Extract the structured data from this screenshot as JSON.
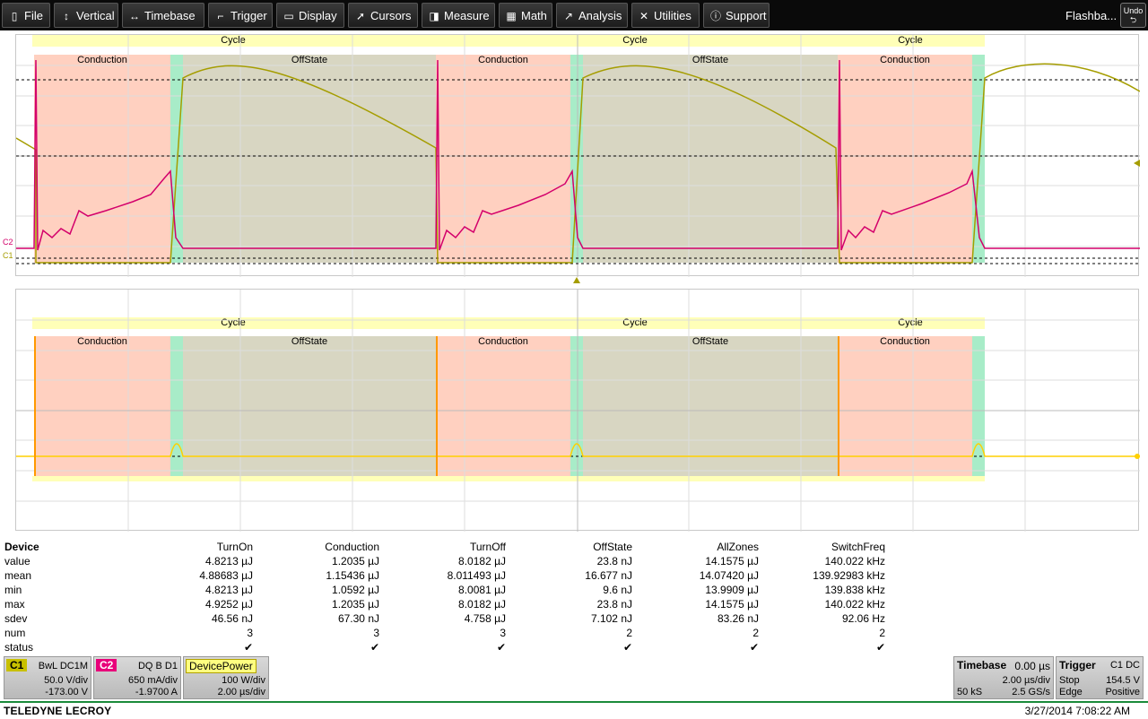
{
  "menu": {
    "file": "File",
    "vertical": "Vertical",
    "timebase": "Timebase",
    "trigger": "Trigger",
    "display": "Display",
    "cursors": "Cursors",
    "measure": "Measure",
    "math": "Math",
    "analysis": "Analysis",
    "utilities": "Utilities",
    "support": "Support",
    "flashback": "Flashba...",
    "undo": "Undo"
  },
  "zones": {
    "cycle": "Cycle",
    "conduction": "Conduction",
    "offstate": "OffState"
  },
  "trace_labels": {
    "c2": "C2",
    "c1": "C1"
  },
  "colors": {
    "conduction": "#ffd0c0",
    "offstate": "#d8d6c2",
    "transition": "#a8ecc8",
    "cycle": "#ffffb8",
    "ch1": "#a59d00",
    "ch2": "#d3006b",
    "device_power": "#ff9900"
  },
  "table": {
    "header": [
      "Device",
      "TurnOn",
      "Conduction",
      "TurnOff",
      "OffState",
      "AllZones",
      "SwitchFreq"
    ],
    "rows": [
      {
        "label": "value",
        "vals": [
          "4.8213 µJ",
          "1.2035 µJ",
          "8.0182 µJ",
          "23.8 nJ",
          "14.1575 µJ",
          "140.022 kHz"
        ]
      },
      {
        "label": "mean",
        "vals": [
          "4.88683 µJ",
          "1.15436 µJ",
          "8.011493 µJ",
          "16.677 nJ",
          "14.07420 µJ",
          "139.92983 kHz"
        ]
      },
      {
        "label": "min",
        "vals": [
          "4.8213 µJ",
          "1.0592 µJ",
          "8.0081 µJ",
          "9.6 nJ",
          "13.9909 µJ",
          "139.838 kHz"
        ]
      },
      {
        "label": "max",
        "vals": [
          "4.9252 µJ",
          "1.2035 µJ",
          "8.0182 µJ",
          "23.8 nJ",
          "14.1575 µJ",
          "140.022 kHz"
        ]
      },
      {
        "label": "sdev",
        "vals": [
          "46.56 nJ",
          "67.30 nJ",
          "4.758 µJ",
          "7.102 nJ",
          "83.26 nJ",
          "92.06 Hz"
        ]
      },
      {
        "label": "num",
        "vals": [
          "3",
          "3",
          "3",
          "2",
          "2",
          "2"
        ]
      },
      {
        "label": "status",
        "vals": [
          "✔",
          "✔",
          "✔",
          "✔",
          "✔",
          "✔"
        ]
      }
    ]
  },
  "c1": {
    "tag": "C1",
    "mode": "BwL DC1M",
    "scale": "50.0 V/div",
    "offset": "-173.00 V"
  },
  "c2": {
    "tag": "C2",
    "mode": "DQ B D1",
    "scale": "650 mA/div",
    "offset": "-1.9700 A"
  },
  "devpower": {
    "tag": "DevicePower",
    "scale": "100 W/div",
    "time": "2.00 µs/div"
  },
  "timebase": {
    "title": "Timebase",
    "delay": "0.00 µs",
    "div": "2.00 µs/div",
    "samples": "50 kS",
    "rate": "2.5 GS/s"
  },
  "trigger": {
    "title": "Trigger",
    "src": "C1 DC",
    "mode": "Stop",
    "level": "154.5 V",
    "type": "Edge",
    "slope": "Positive"
  },
  "footer": {
    "brand": "TELEDYNE LECROY",
    "datetime": "3/27/2014 7:08:22 AM"
  }
}
